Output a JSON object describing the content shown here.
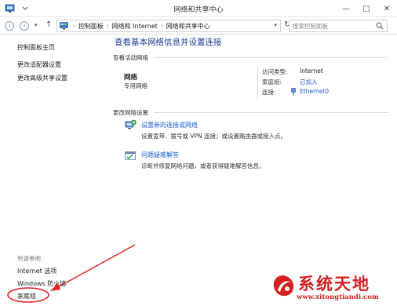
{
  "window": {
    "title": "网络和共享中心"
  },
  "window_controls": {
    "minimize": "—",
    "maximize": "□",
    "close": "✕"
  },
  "address": {
    "crumbs": [
      "控制面板",
      "网络和 Internet",
      "网络和共享中心"
    ],
    "separator": "›"
  },
  "search": {
    "placeholder": "搜索控制面板"
  },
  "sidebar": {
    "links": [
      "控制面板主页",
      "更改适配器设置",
      "更改高级共享设置"
    ],
    "see_also": {
      "heading": "另请参阅",
      "links": [
        "Internet 选项",
        "Windows 防火墙",
        "家庭组"
      ]
    }
  },
  "main": {
    "title": "查看基本网络信息并设置连接",
    "active_networks": {
      "heading": "查看活动网络",
      "name": "网络",
      "type": "专用网络",
      "access_type_label": "访问类型:",
      "access_type_value": "Internet",
      "homegroup_label": "家庭组:",
      "homegroup_value": "已加入",
      "connection_label": "连接:",
      "connection_value": "Ethernet0"
    },
    "change_settings": {
      "heading": "更改网络设置",
      "tasks": [
        {
          "link": "设置新的连接或网络",
          "desc": "设置宽带、拨号或 VPN 连接；或设置路由器或接入点。",
          "icon": "network-setup-icon"
        },
        {
          "link": "问题疑难解答",
          "desc": "诊断并修复网络问题，或者获得疑难解答信息。",
          "icon": "troubleshoot-icon"
        }
      ]
    }
  },
  "watermark": {
    "title": "系统天地",
    "url": "www.xitongtiandi.com"
  },
  "colors": {
    "link": "#1a5cc8",
    "title": "#1a3a9a",
    "annotation": "#e02020",
    "watermark": "#d42020"
  }
}
